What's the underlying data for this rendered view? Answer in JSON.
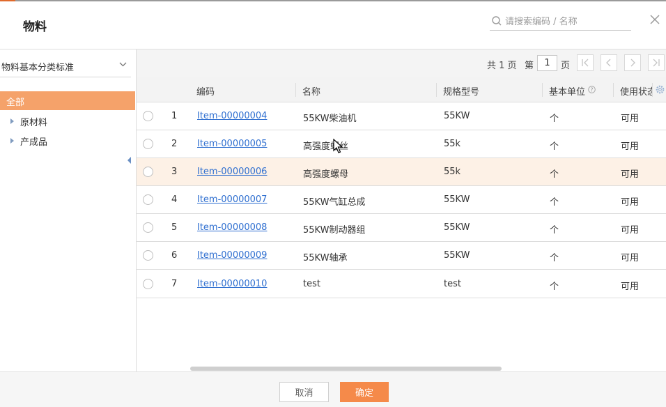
{
  "dialog": {
    "title": "物料"
  },
  "search": {
    "placeholder": "请搜索编码 / 名称"
  },
  "classification": {
    "selected": "物料基本分类标准"
  },
  "tree": {
    "all_label": "全部",
    "nodes": [
      {
        "label": "原材料"
      },
      {
        "label": "产成品"
      }
    ]
  },
  "pager": {
    "total_text": "共 1 页",
    "pre_text": "第",
    "current_page": "1",
    "post_text": "页"
  },
  "table": {
    "headers": {
      "code": "编码",
      "name": "名称",
      "spec": "规格型号",
      "unit": "基本单位",
      "status": "使用状态"
    },
    "rows": [
      {
        "index": "1",
        "code": "Item-00000004",
        "name": "55KW柴油机",
        "spec": "55KW",
        "unit": "个",
        "status": "可用"
      },
      {
        "index": "2",
        "code": "Item-00000005",
        "name": "高强度螺丝",
        "spec": "55k",
        "unit": "个",
        "status": "可用"
      },
      {
        "index": "3",
        "code": "Item-00000006",
        "name": "高强度螺母",
        "spec": "55k",
        "unit": "个",
        "status": "可用"
      },
      {
        "index": "4",
        "code": "Item-00000007",
        "name": "55KW气缸总成",
        "spec": "55KW",
        "unit": "个",
        "status": "可用"
      },
      {
        "index": "5",
        "code": "Item-00000008",
        "name": "55KW制动器组",
        "spec": "55KW",
        "unit": "个",
        "status": "可用"
      },
      {
        "index": "6",
        "code": "Item-00000009",
        "name": "55KW轴承",
        "spec": "55KW",
        "unit": "个",
        "status": "可用"
      },
      {
        "index": "7",
        "code": "Item-00000010",
        "name": "test",
        "spec": "test",
        "unit": "个",
        "status": "可用"
      }
    ]
  },
  "footer": {
    "cancel_label": "取消",
    "ok_label": "确定"
  },
  "colors": {
    "accent": "#f58a4a",
    "selected_tree": "#f5a26a",
    "link": "#2f6fd0",
    "row_highlight": "#fdf1e6"
  }
}
